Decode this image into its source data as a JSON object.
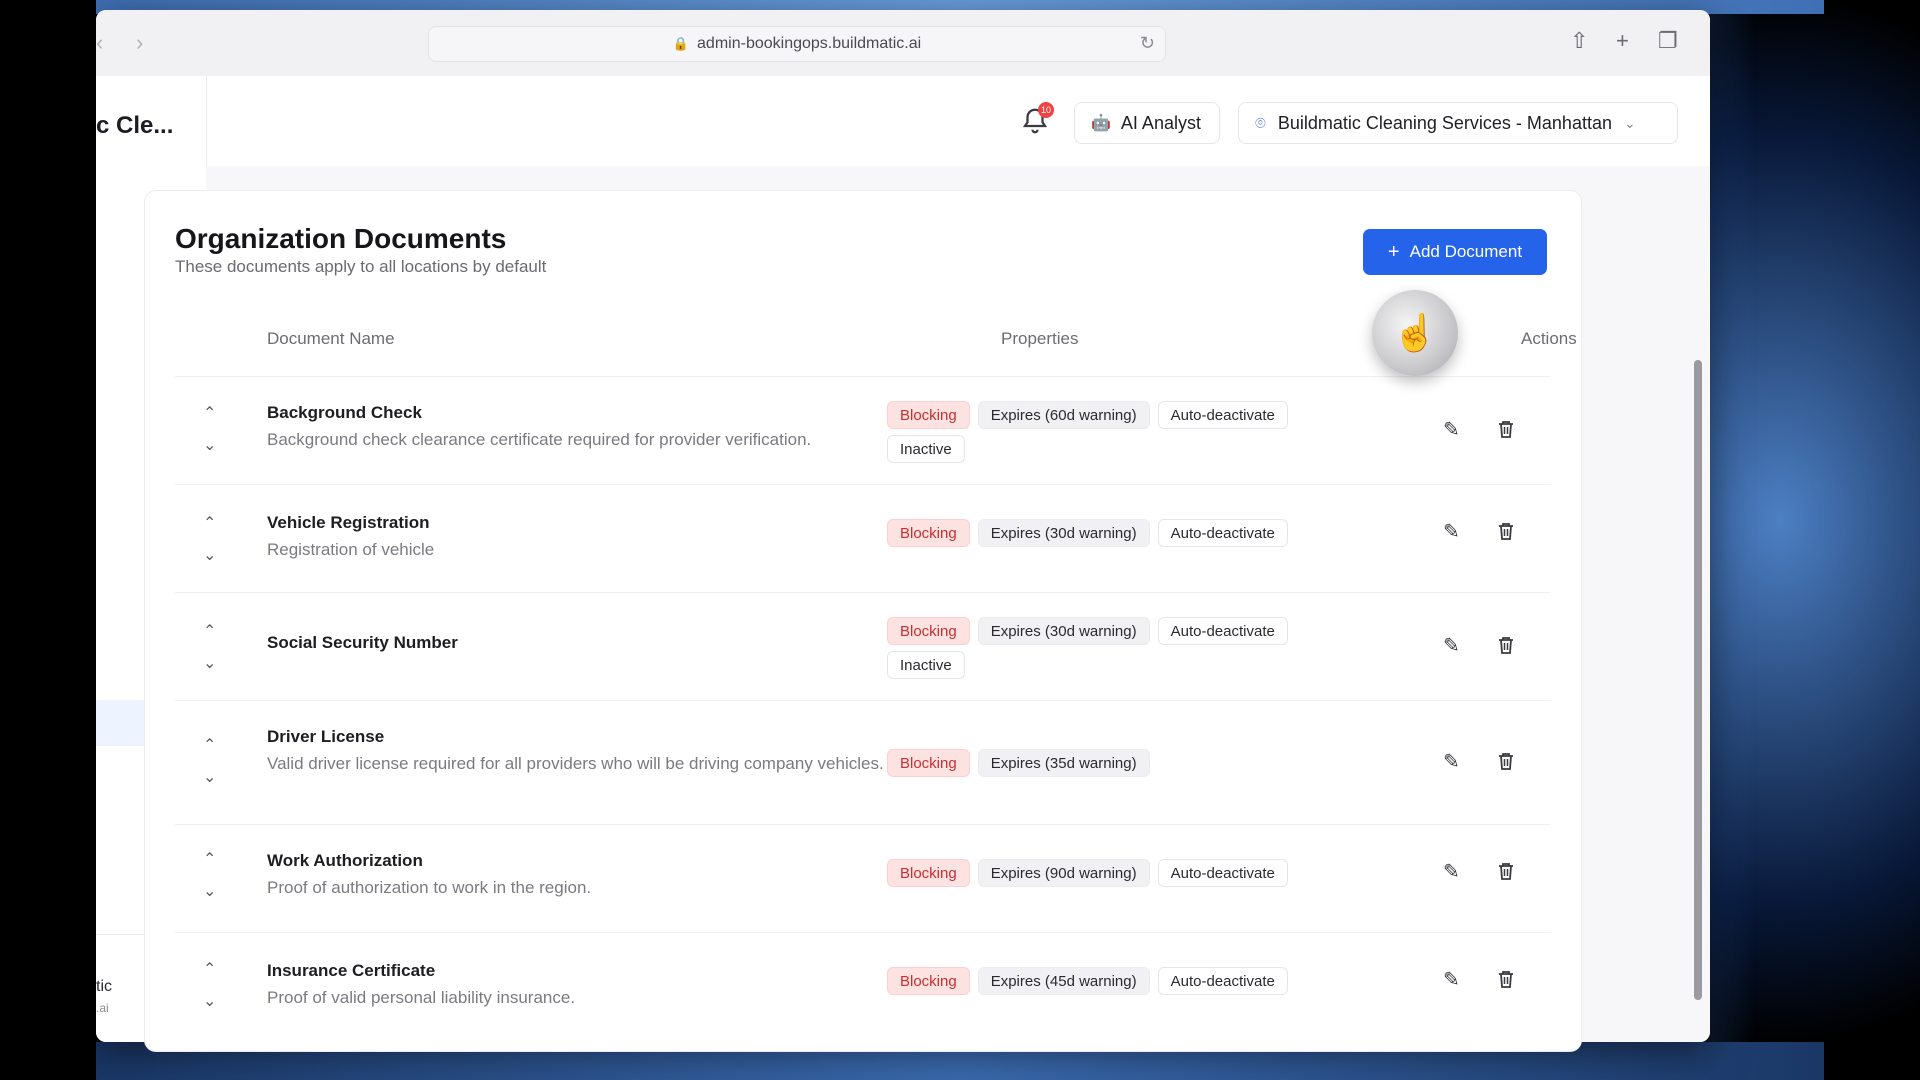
{
  "browser": {
    "url": "admin-bookingops.buildmatic.ai",
    "back_glyph": "‹",
    "forward_glyph": "›"
  },
  "sidebar": {
    "brand": "c Cle...",
    "user_name": "tic",
    "user_sub": ".ai"
  },
  "header": {
    "notification_count": "10",
    "ai_analyst_label": "AI Analyst",
    "location_label": "Buildmatic Cleaning Services - Manhattan"
  },
  "card": {
    "title": "Organization Documents",
    "subtitle": "These documents apply to all locations by default",
    "add_label": "Add Document",
    "columns": {
      "name": "Document Name",
      "properties": "Properties",
      "actions": "Actions"
    }
  },
  "documents": [
    {
      "name": "Background Check",
      "description": "Background check clearance certificate required for provider verification.",
      "properties": [
        "Blocking",
        "Expires (60d warning)",
        "Auto-deactivate",
        "Inactive"
      ]
    },
    {
      "name": "Vehicle Registration",
      "description": "Registration of vehicle",
      "properties": [
        "Blocking",
        "Expires (30d warning)",
        "Auto-deactivate"
      ]
    },
    {
      "name": "Social Security Number",
      "description": "",
      "properties": [
        "Blocking",
        "Expires (30d warning)",
        "Auto-deactivate",
        "Inactive"
      ]
    },
    {
      "name": "Driver License",
      "description": "Valid driver license required for all providers who will be driving company vehicles.",
      "properties": [
        "Blocking",
        "Expires (35d warning)"
      ]
    },
    {
      "name": "Work Authorization",
      "description": "Proof of authorization to work in the region.",
      "properties": [
        "Blocking",
        "Expires (90d warning)",
        "Auto-deactivate"
      ]
    },
    {
      "name": "Insurance Certificate",
      "description": "Proof of valid personal liability insurance.",
      "properties": [
        "Blocking",
        "Expires (45d warning)",
        "Auto-deactivate"
      ]
    }
  ],
  "colors": {
    "accent": "#2563eb",
    "blocking_bg": "#fde2e2",
    "blocking_text": "#c53030"
  }
}
